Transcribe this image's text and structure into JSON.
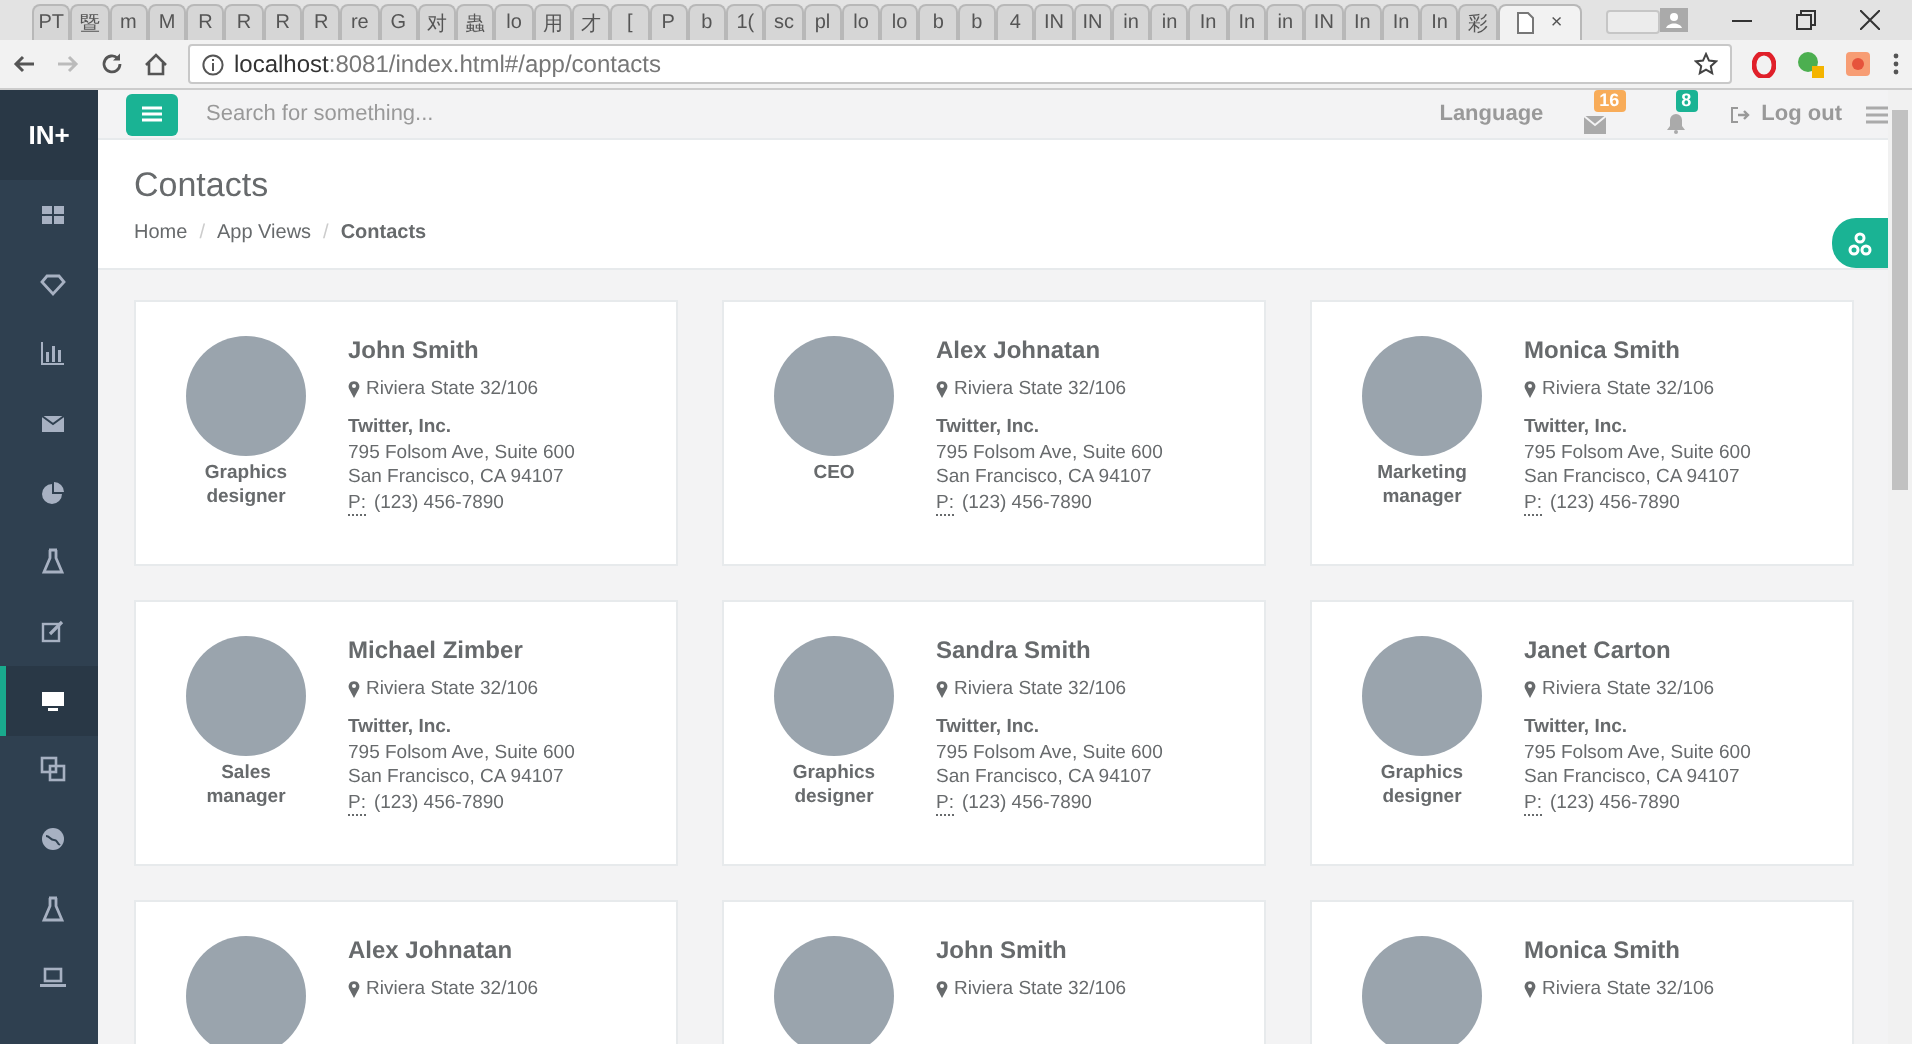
{
  "browser": {
    "tabs": [
      {
        "label": "PT",
        "selected": false
      },
      {
        "label": "暨",
        "selected": false
      },
      {
        "label": "m",
        "selected": false
      },
      {
        "label": "M",
        "selected": false
      },
      {
        "label": "R",
        "selected": false
      },
      {
        "label": "R",
        "selected": false
      },
      {
        "label": "R",
        "selected": false
      },
      {
        "label": "R",
        "selected": false
      },
      {
        "label": "re",
        "selected": false
      },
      {
        "label": "G",
        "selected": false
      },
      {
        "label": "对",
        "selected": false
      },
      {
        "label": "蟲",
        "selected": false
      },
      {
        "label": "lo",
        "selected": false
      },
      {
        "label": "用",
        "selected": false
      },
      {
        "label": "才",
        "selected": false
      },
      {
        "label": "[",
        "selected": false
      },
      {
        "label": "P",
        "selected": false
      },
      {
        "label": "b",
        "selected": false
      },
      {
        "label": "1(",
        "selected": false
      },
      {
        "label": "sc",
        "selected": false
      },
      {
        "label": "pl",
        "selected": false
      },
      {
        "label": "lo",
        "selected": false
      },
      {
        "label": "lo",
        "selected": false
      },
      {
        "label": "b",
        "selected": false
      },
      {
        "label": "b",
        "selected": false
      },
      {
        "label": "4",
        "selected": false
      },
      {
        "label": "IN",
        "selected": false
      },
      {
        "label": "IN",
        "selected": false
      },
      {
        "label": "in",
        "selected": false
      },
      {
        "label": "in",
        "selected": false
      },
      {
        "label": "In",
        "selected": false
      },
      {
        "label": "In",
        "selected": false
      },
      {
        "label": "in",
        "selected": false
      },
      {
        "label": "IN",
        "selected": false
      },
      {
        "label": "In",
        "selected": false
      },
      {
        "label": "In",
        "selected": false
      },
      {
        "label": "In",
        "selected": false
      },
      {
        "label": "彩",
        "selected": false
      },
      {
        "selected": true
      }
    ],
    "tab_close": "×",
    "url_host": "localhost",
    "url_rest": ":8081/index.html#/app/contacts"
  },
  "sidebar": {
    "logo": "IN+",
    "items": [
      {
        "selected": false
      },
      {
        "selected": false
      },
      {
        "selected": false
      },
      {
        "selected": false
      },
      {
        "selected": false
      },
      {
        "selected": false
      },
      {
        "selected": false
      },
      {
        "selected": true
      },
      {
        "selected": false
      },
      {
        "selected": false
      },
      {
        "selected": false
      },
      {
        "selected": false
      }
    ]
  },
  "topbar": {
    "search": {
      "placeholder": "Search for something..."
    },
    "language": "Language",
    "mail_count": "16",
    "alert_count": "8",
    "logout": "Log out"
  },
  "page_title": "Contacts",
  "breadcrumbs": [
    {
      "label": "Home",
      "current": false
    },
    {
      "separator": "/",
      "label": "App Views",
      "current": false
    },
    {
      "separator": "/",
      "label": "Contacts",
      "current": true
    }
  ],
  "contacts": [
    {
      "name": "John Smith",
      "address": "Riviera State 32/106",
      "company": "Twitter, Inc.",
      "street": "795 Folsom Ave, Suite 600",
      "city": "San Francisco, CA 94107",
      "phone_label": "P:",
      "phone": "(123) 456-7890",
      "role": "Graphics designer"
    },
    {
      "name": "Alex Johnatan",
      "address": "Riviera State 32/106",
      "company": "Twitter, Inc.",
      "street": "795 Folsom Ave, Suite 600",
      "city": "San Francisco, CA 94107",
      "phone_label": "P:",
      "phone": "(123) 456-7890",
      "role": "CEO"
    },
    {
      "name": "Monica Smith",
      "address": "Riviera State 32/106",
      "company": "Twitter, Inc.",
      "street": "795 Folsom Ave, Suite 600",
      "city": "San Francisco, CA 94107",
      "phone_label": "P:",
      "phone": "(123) 456-7890",
      "role": "Marketing manager"
    },
    {
      "name": "Michael Zimber",
      "address": "Riviera State 32/106",
      "company": "Twitter, Inc.",
      "street": "795 Folsom Ave, Suite 600",
      "city": "San Francisco, CA 94107",
      "phone_label": "P:",
      "phone": "(123) 456-7890",
      "role": "Sales manager"
    },
    {
      "name": "Sandra Smith",
      "address": "Riviera State 32/106",
      "company": "Twitter, Inc.",
      "street": "795 Folsom Ave, Suite 600",
      "city": "San Francisco, CA 94107",
      "phone_label": "P:",
      "phone": "(123) 456-7890",
      "role": "Graphics designer"
    },
    {
      "name": "Janet Carton",
      "address": "Riviera State 32/106",
      "company": "Twitter, Inc.",
      "street": "795 Folsom Ave, Suite 600",
      "city": "San Francisco, CA 94107",
      "phone_label": "P:",
      "phone": "(123) 456-7890",
      "role": "Graphics designer"
    },
    {
      "name": "Alex Johnatan",
      "address": "Riviera State 32/106"
    },
    {
      "name": "John Smith",
      "address": "Riviera State 32/106"
    },
    {
      "name": "Monica Smith",
      "address": "Riviera State 32/106"
    }
  ]
}
